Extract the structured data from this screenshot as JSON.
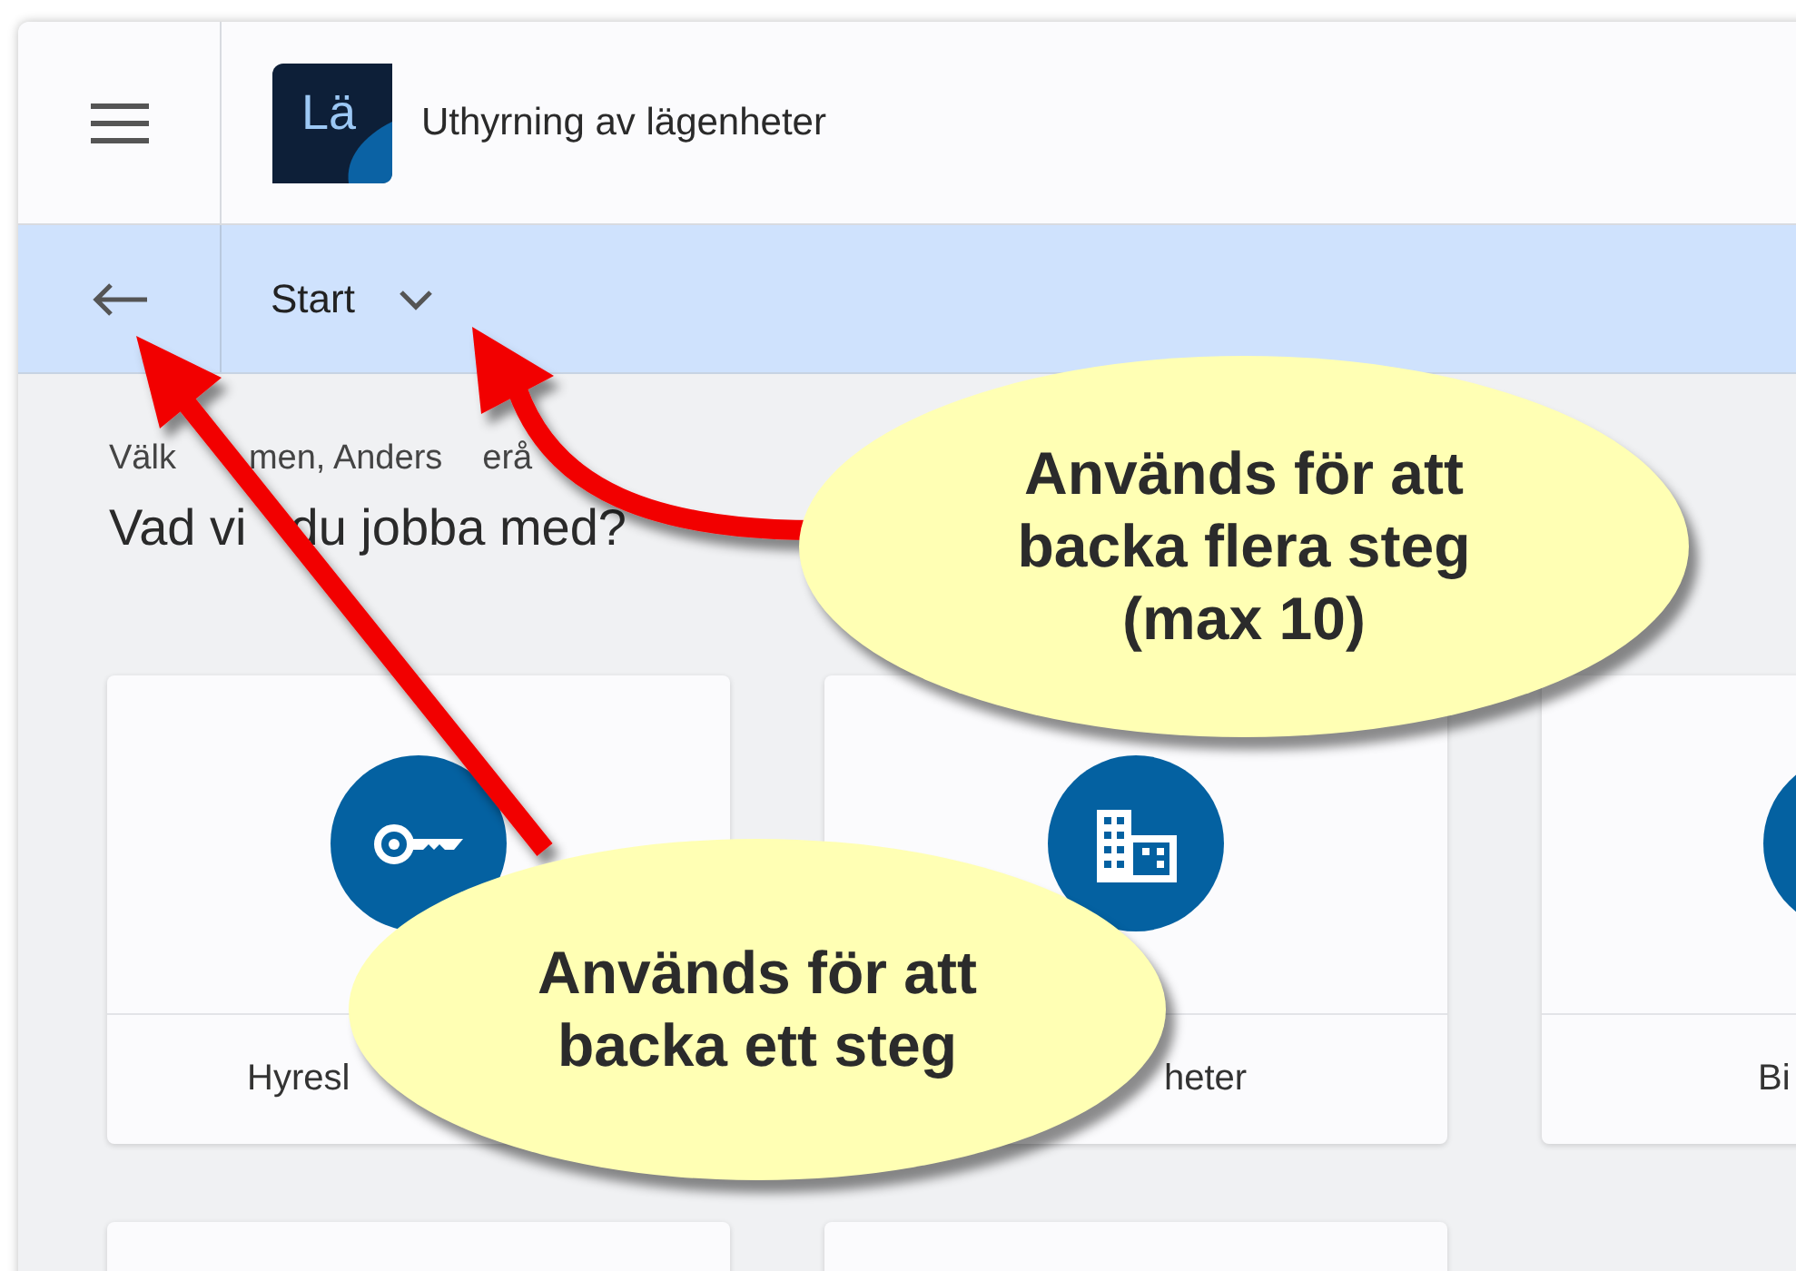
{
  "app": {
    "logo": "Lä",
    "title": "Uthyrning av lägenheter"
  },
  "toolbar": {
    "breadcrumb": "Start"
  },
  "greeting": [
    "Välk",
    "men, Anders",
    "erå"
  ],
  "heading": [
    "Vad vi",
    "du jobba med?"
  ],
  "cards": [
    {
      "label": "Hyresl",
      "kind": "key"
    },
    {
      "label": "heter",
      "kind": "building"
    },
    {
      "label": "Bi",
      "kind": "partial"
    }
  ],
  "callouts": [
    {
      "text": "Används för att\nbacka flera steg\n(max 10)"
    },
    {
      "text": "Används för att\nbacka ett steg"
    }
  ]
}
